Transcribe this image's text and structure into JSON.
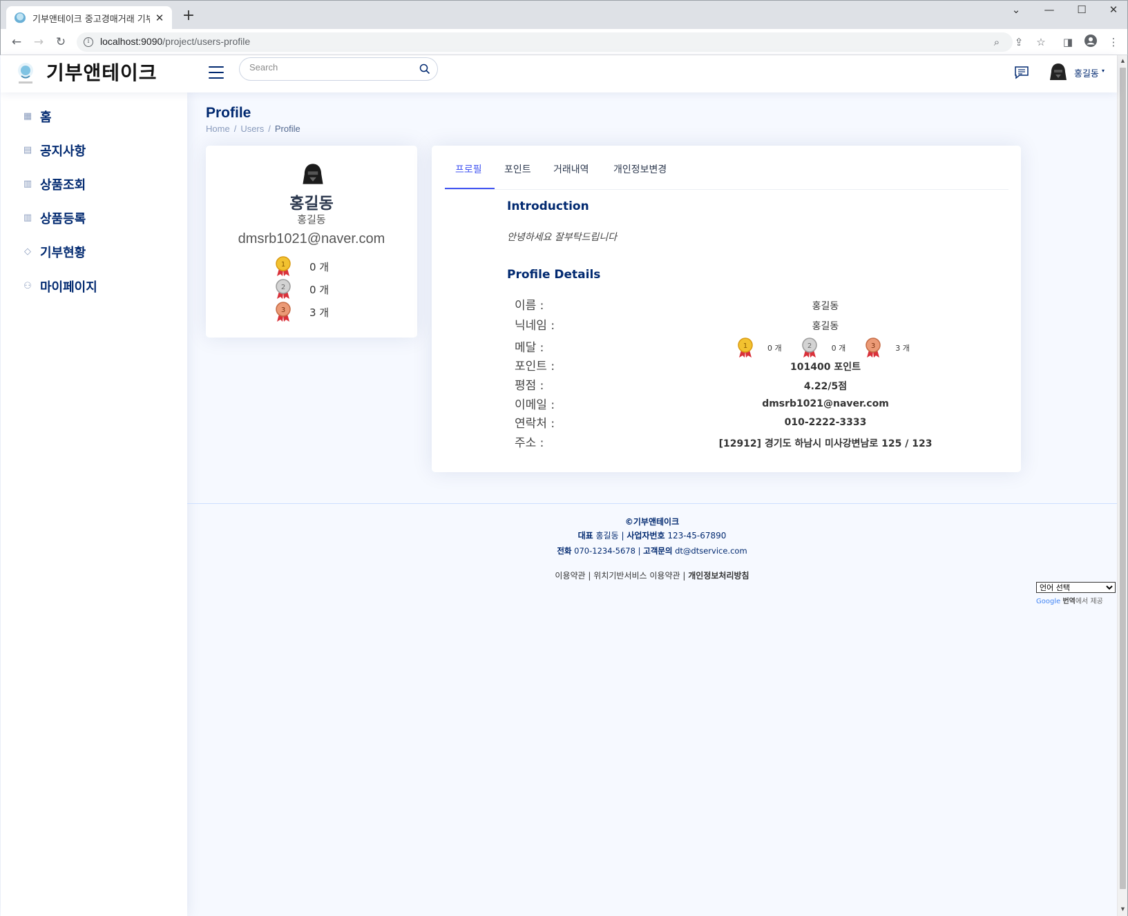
{
  "browser": {
    "tab_title": "기부앤테이크 중고경매거래 기부",
    "url_host": "localhost:9090",
    "url_path": "/project/users-profile",
    "new_tab": "+",
    "close_tab": "✕"
  },
  "header": {
    "logo_text": "기부앤테이크",
    "search_placeholder": "Search",
    "user_name": "홍길동",
    "caret": "▾"
  },
  "sidebar": {
    "items": [
      {
        "label": "홈",
        "icon": "grid-icon"
      },
      {
        "label": "공지사항",
        "icon": "journal-icon"
      },
      {
        "label": "상품조회",
        "icon": "layout-icon"
      },
      {
        "label": "상품등록",
        "icon": "layout-icon"
      },
      {
        "label": "기부현황",
        "icon": "gem-icon"
      },
      {
        "label": "마이페이지",
        "icon": "person-icon"
      }
    ]
  },
  "page": {
    "title": "Profile",
    "breadcrumb": [
      "Home",
      "Users",
      "Profile"
    ],
    "breadcrumb_sep": "/"
  },
  "profile_card": {
    "name": "홍길동",
    "nickname": "홍길동",
    "email": "dmsrb1021@naver.com",
    "medals": [
      {
        "rank": "1",
        "count": "0 개",
        "color": "#f2c230"
      },
      {
        "rank": "2",
        "count": "0 개",
        "color": "#c9c9c9"
      },
      {
        "rank": "3",
        "count": "3 개",
        "color": "#e8916a"
      }
    ]
  },
  "tabs": [
    {
      "label": "프로필",
      "active": true
    },
    {
      "label": "포인트",
      "active": false
    },
    {
      "label": "거래내역",
      "active": false
    },
    {
      "label": "개인정보변경",
      "active": false
    }
  ],
  "overview": {
    "intro_title": "Introduction",
    "intro_text": "안녕하세요 잘부탁드립니다",
    "details_title": "Profile Details",
    "rows": [
      {
        "label": "이름 :",
        "value": "홍길동"
      },
      {
        "label": "닉네임 :",
        "value": "홍길동"
      },
      {
        "label": "메달 :",
        "value": ""
      },
      {
        "label": "포인트 :",
        "value": "101400 포인트"
      },
      {
        "label": "평점 :",
        "value": "4.22/5점"
      },
      {
        "label": "이메일 :",
        "value": "dmsrb1021@naver.com"
      },
      {
        "label": "연락처 :",
        "value": "010-2222-3333"
      },
      {
        "label": "주소 :",
        "value": "[12912] 경기도 하남시 미사강변남로 125 / 123"
      }
    ],
    "medal_counts": [
      "0 개",
      "0 개",
      "3 개"
    ]
  },
  "footer": {
    "copyright": "©기부앤테이크",
    "rep_label": "대표",
    "rep_value": "홍길동",
    "biz_label": "사업자번호",
    "biz_value": "123-45-67890",
    "tel_label": "전화",
    "tel_value": "070-1234-5678",
    "inq_label": "고객문의",
    "inq_value": "dt@dtservice.com",
    "link1": "이용약관",
    "link2": "위치기반서비스 이용약관",
    "link3": "개인정보처리방침",
    "divider": "|"
  },
  "translate": {
    "select_label": "언어 선택",
    "google": "Google",
    "brand": "번역",
    "suffix": "에서 제공"
  },
  "colors": {
    "brand": "#012970",
    "accent": "#4154f1",
    "bg": "#f6f9ff"
  }
}
